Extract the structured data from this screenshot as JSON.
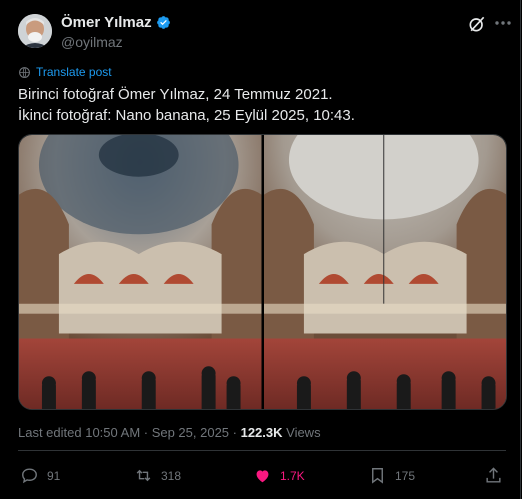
{
  "author": {
    "name": "Ömer Yılmaz",
    "handle": "@oyilmaz",
    "verified": true
  },
  "translate_label": "Translate post",
  "post_lines": [
    "Birinci fotoğraf Ömer Yılmaz, 24 Temmuz 2021.",
    "İkinci fotoğraf: Nano banana, 25 Eylül 2025, 10:43."
  ],
  "media": [
    {
      "description": "mosque-interior-photo-1"
    },
    {
      "description": "mosque-interior-photo-2"
    }
  ],
  "meta": {
    "edited": "Last edited 10:50 AM · Sep 25, 2025 · ",
    "views_count": "122.3K",
    "views_label": " Views"
  },
  "actions": {
    "replies": "91",
    "reposts": "318",
    "likes": "1.7K",
    "bookmarks": "175"
  },
  "colors": {
    "accent": "#1d9bf0",
    "like": "#f91880",
    "muted": "#71767b",
    "text": "#e7e9ea",
    "background": "#000000"
  },
  "icons": [
    "verified-badge-icon",
    "grok-icon",
    "more-icon",
    "translate-icon",
    "reply-icon",
    "repost-icon",
    "like-icon",
    "bookmark-icon",
    "share-icon"
  ]
}
